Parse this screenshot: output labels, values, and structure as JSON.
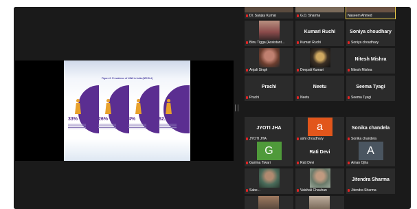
{
  "slide": {
    "title": "Figure 2: Prevalence of VAW in India (NFHS-4)"
  },
  "stats": [
    {
      "pct": "33%"
    },
    {
      "pct": "26%"
    },
    {
      "pct": "4%"
    },
    {
      "pct": "62.8%"
    }
  ],
  "participants": [
    {
      "label": "Dr. Sanjay Kumar",
      "type": "photo-strip",
      "bg": "#5a4a3e"
    },
    {
      "label": "G.D. Sharma",
      "type": "photo-strip",
      "bg": "#7a6a5a"
    },
    {
      "label": "Naseem Ahmed",
      "type": "photo-strip",
      "bg": "#6a5243",
      "active": true
    },
    {
      "label": "Binu Tigga (Assistant...",
      "type": "photo",
      "bg": "#8a4a4a"
    },
    {
      "name": "Kumari Ruchi",
      "label": "Kumari Ruchi",
      "type": "name"
    },
    {
      "name": "Soniya choudhary",
      "label": "Soniya choudhary",
      "type": "name"
    },
    {
      "label": "Anjali Singh",
      "type": "photo",
      "bg": "#6b3d2e"
    },
    {
      "label": "Deepali Kumari",
      "type": "photo",
      "bg": "#3b2f24"
    },
    {
      "name": "Nitesh Mishra",
      "label": "Nitesh Mishra",
      "type": "name"
    },
    {
      "name": "Prachi",
      "label": "Prachi",
      "type": "name"
    },
    {
      "name": "Neetu",
      "label": "Neetu",
      "type": "name"
    },
    {
      "name": "Seema Tyagi",
      "label": "Seema Tyagi",
      "type": "name"
    },
    {
      "name": "JYOTI JHA",
      "label": "JYOTI JHA",
      "type": "name"
    },
    {
      "letter": "a",
      "label": "ashi choudhary",
      "type": "letter",
      "bg": "#e2561b"
    },
    {
      "name": "Sonika chandela",
      "label": "Sonika chandela",
      "type": "name"
    },
    {
      "letter": "G",
      "label": "Garima Tiwari",
      "type": "letter",
      "bg": "#4f9a3a"
    },
    {
      "name": "Rati Devi",
      "label": "Rati Devi",
      "type": "name"
    },
    {
      "letter": "A",
      "label": "Aman Ojha",
      "type": "letter",
      "bg": "#4a5560"
    },
    {
      "label": "Sabe...",
      "type": "photo",
      "bg": "#4a6b5a"
    },
    {
      "label": "Vaishali Chauhan",
      "type": "photo",
      "bg": "#6a7a6a"
    },
    {
      "name": "Jitendra Sharma",
      "label": "Jitendra Sharma",
      "type": "name"
    }
  ],
  "colors": {
    "accent": "#5b2e91",
    "mic_muted": "#e02424",
    "active_speaker": "#f2d24b"
  }
}
